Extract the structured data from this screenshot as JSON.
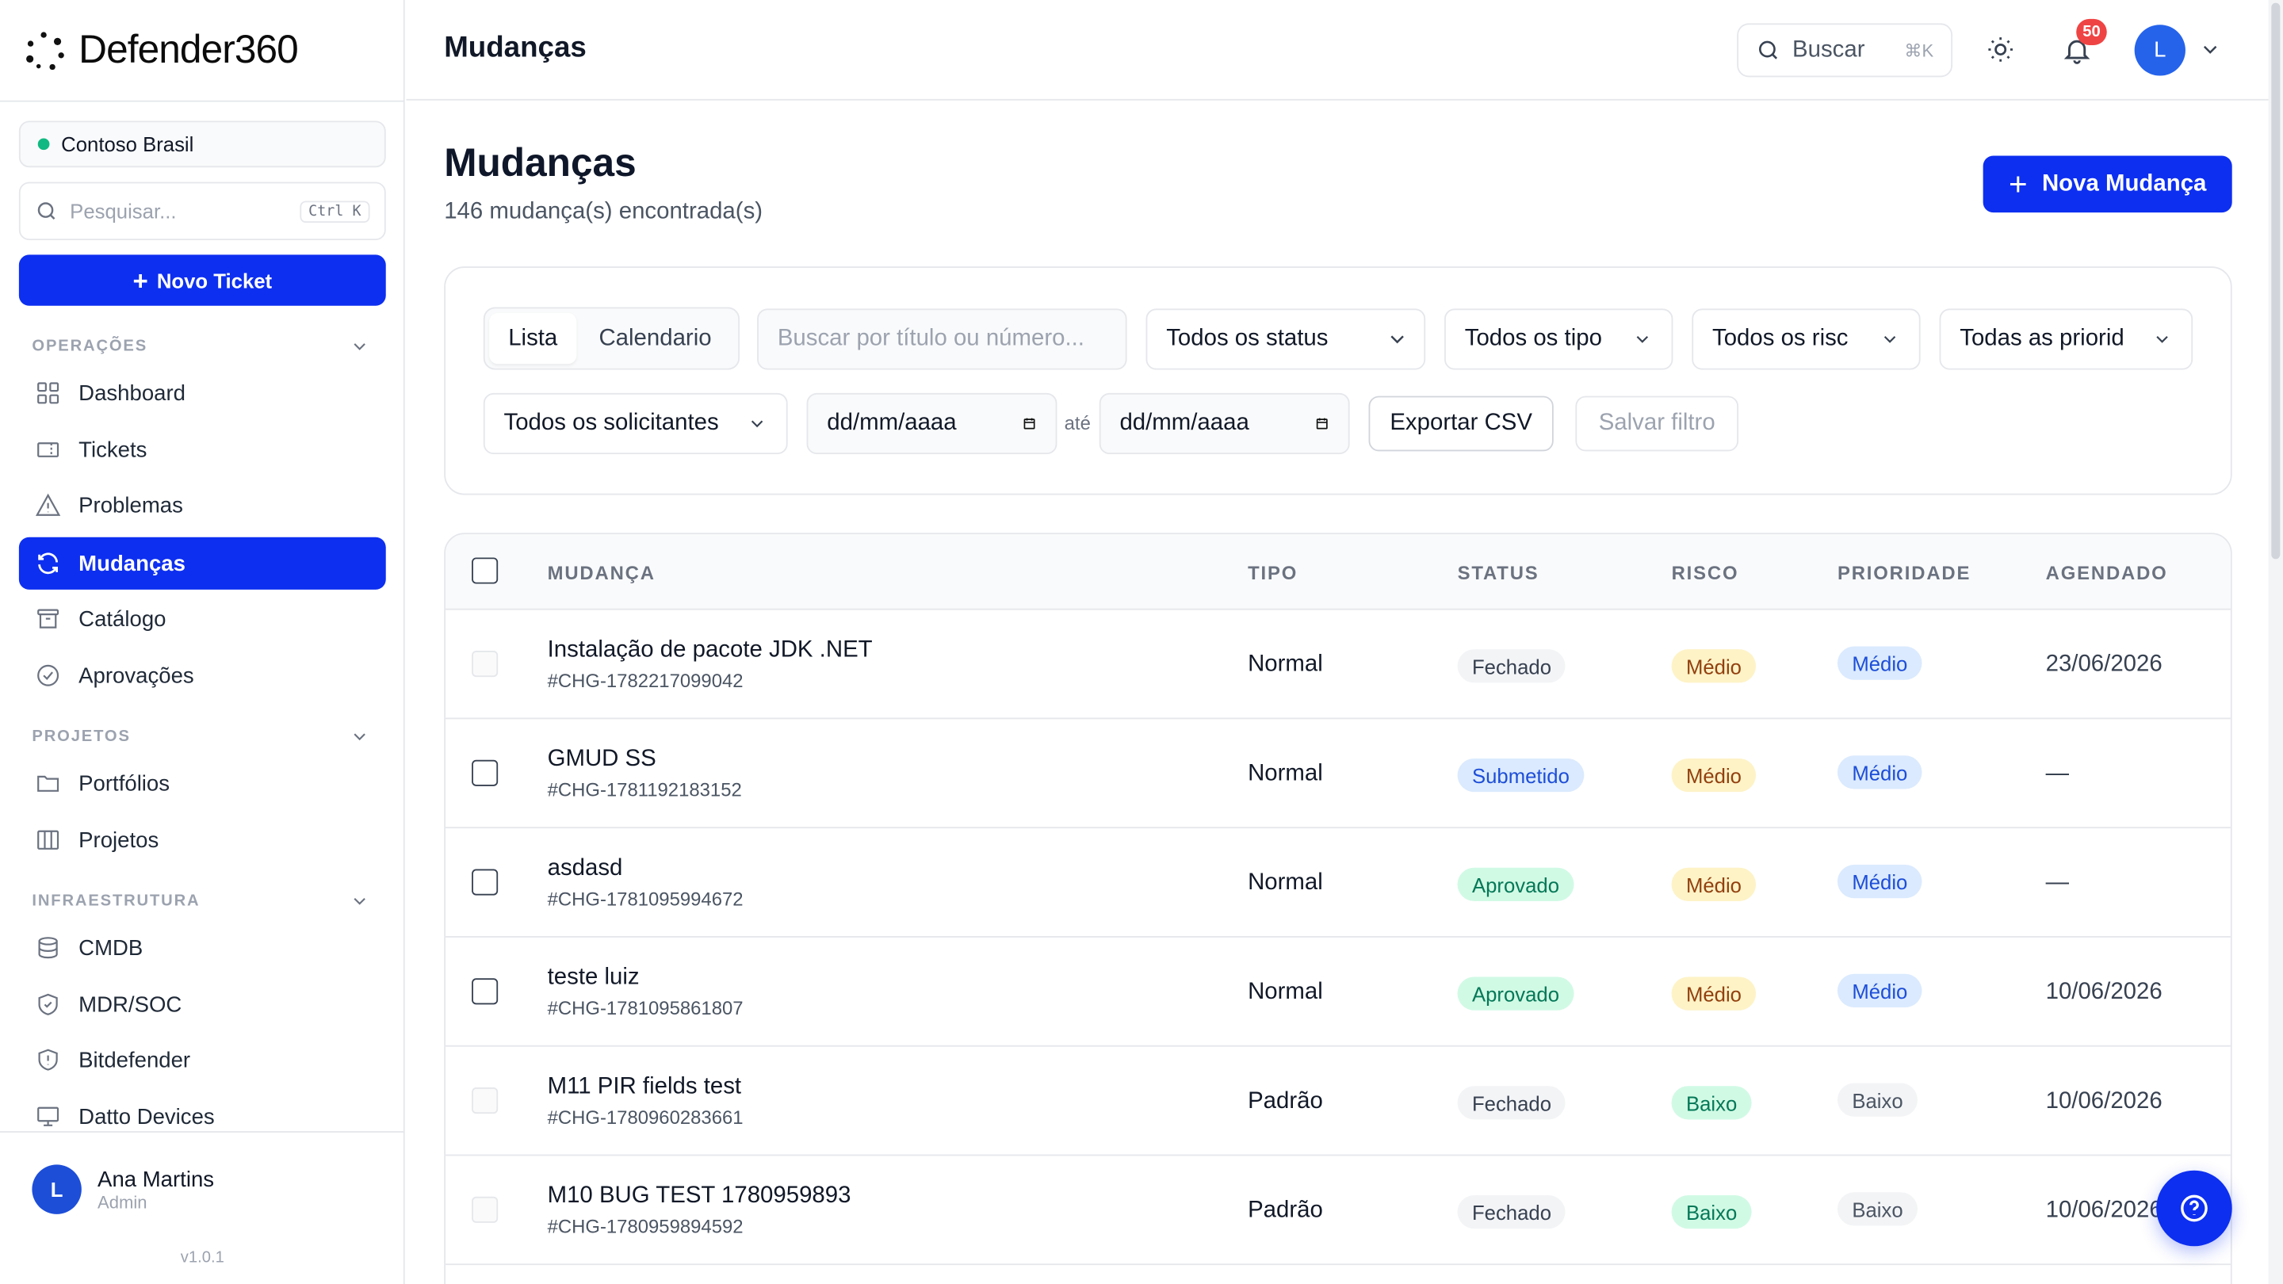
{
  "brand": {
    "name": "Defender360"
  },
  "tenant": {
    "name": "Contoso Brasil"
  },
  "sidebar": {
    "search_placeholder": "Pesquisar...",
    "search_shortcut": "Ctrl K",
    "new_ticket_label": "Novo Ticket",
    "sections": [
      {
        "title": "OPERAÇÕES",
        "items": [
          "Dashboard",
          "Tickets",
          "Problemas",
          "Mudanças",
          "Catálogo",
          "Aprovações"
        ]
      },
      {
        "title": "PROJETOS",
        "items": [
          "Portfólios",
          "Projetos"
        ]
      },
      {
        "title": "INFRAESTRUTURA",
        "items": [
          "CMDB",
          "MDR/SOC",
          "Bitdefender",
          "Datto Devices"
        ]
      }
    ],
    "active_item": "Mudanças",
    "user": {
      "initial": "L",
      "name": "Ana Martins",
      "role": "Admin"
    },
    "version": "v1.0.1"
  },
  "topbar": {
    "title": "Mudanças",
    "search_label": "Buscar",
    "search_shortcut": "⌘K",
    "notifications_count": "50",
    "avatar_initial": "L"
  },
  "page": {
    "title": "Mudanças",
    "subtitle": "146 mudança(s) encontrada(s)",
    "new_button": "Nova Mudança"
  },
  "filters": {
    "view_tabs": [
      "Lista",
      "Calendario"
    ],
    "active_view": "Lista",
    "search_placeholder": "Buscar por título ou número...",
    "status": "Todos os status",
    "tipo": "Todos os tipo",
    "risco": "Todos os risc",
    "prioridade": "Todas as priorid",
    "solicitantes": "Todos os solicitantes",
    "date_from": "dd/mm/aaaa",
    "date_sep": "até",
    "date_to": "dd/mm/aaaa",
    "export_label": "Exportar CSV",
    "save_label": "Salvar filtro"
  },
  "table": {
    "columns": [
      "MUDANÇA",
      "TIPO",
      "STATUS",
      "RISCO",
      "PRIORIDADE",
      "AGENDADO"
    ],
    "rows": [
      {
        "title": "Instalação de pacote JDK .NET",
        "number": "#CHG-1782217099042",
        "tipo": "Normal",
        "status": "Fechado",
        "risco": "Médio",
        "prioridade": "Médio",
        "agendado": "23/06/2026",
        "selectable": false
      },
      {
        "title": "GMUD SS",
        "number": "#CHG-1781192183152",
        "tipo": "Normal",
        "status": "Submetido",
        "risco": "Médio",
        "prioridade": "Médio",
        "agendado": "—",
        "selectable": true
      },
      {
        "title": "asdasd",
        "number": "#CHG-1781095994672",
        "tipo": "Normal",
        "status": "Aprovado",
        "risco": "Médio",
        "prioridade": "Médio",
        "agendado": "—",
        "selectable": true
      },
      {
        "title": "teste luiz",
        "number": "#CHG-1781095861807",
        "tipo": "Normal",
        "status": "Aprovado",
        "risco": "Médio",
        "prioridade": "Médio",
        "agendado": "10/06/2026",
        "selectable": true
      },
      {
        "title": "M11 PIR fields test",
        "number": "#CHG-1780960283661",
        "tipo": "Padrão",
        "status": "Fechado",
        "risco": "Baixo",
        "prioridade": "Baixo",
        "agendado": "10/06/2026",
        "selectable": false
      },
      {
        "title": "M10 BUG TEST 1780959893",
        "number": "#CHG-1780959894592",
        "tipo": "Padrão",
        "status": "Fechado",
        "risco": "Baixo",
        "prioridade": "Baixo",
        "agendado": "10/06/2026",
        "selectable": false
      }
    ]
  },
  "colors": {
    "accent": "#0d2ff0",
    "status": {
      "Fechado": [
        "#f3f4f6",
        "#374151"
      ],
      "Submetido": [
        "#dbeafe",
        "#1d4ed8"
      ],
      "Aprovado": [
        "#d1fae5",
        "#047857"
      ]
    },
    "risco": {
      "Médio": [
        "#fef3c7",
        "#92400e"
      ],
      "Baixo": [
        "#d1fae5",
        "#047857"
      ]
    },
    "prioridade": {
      "Médio": [
        "#dbeafe",
        "#1d4ed8"
      ],
      "Baixo": [
        "#f3f4f6",
        "#4b5563"
      ]
    }
  }
}
